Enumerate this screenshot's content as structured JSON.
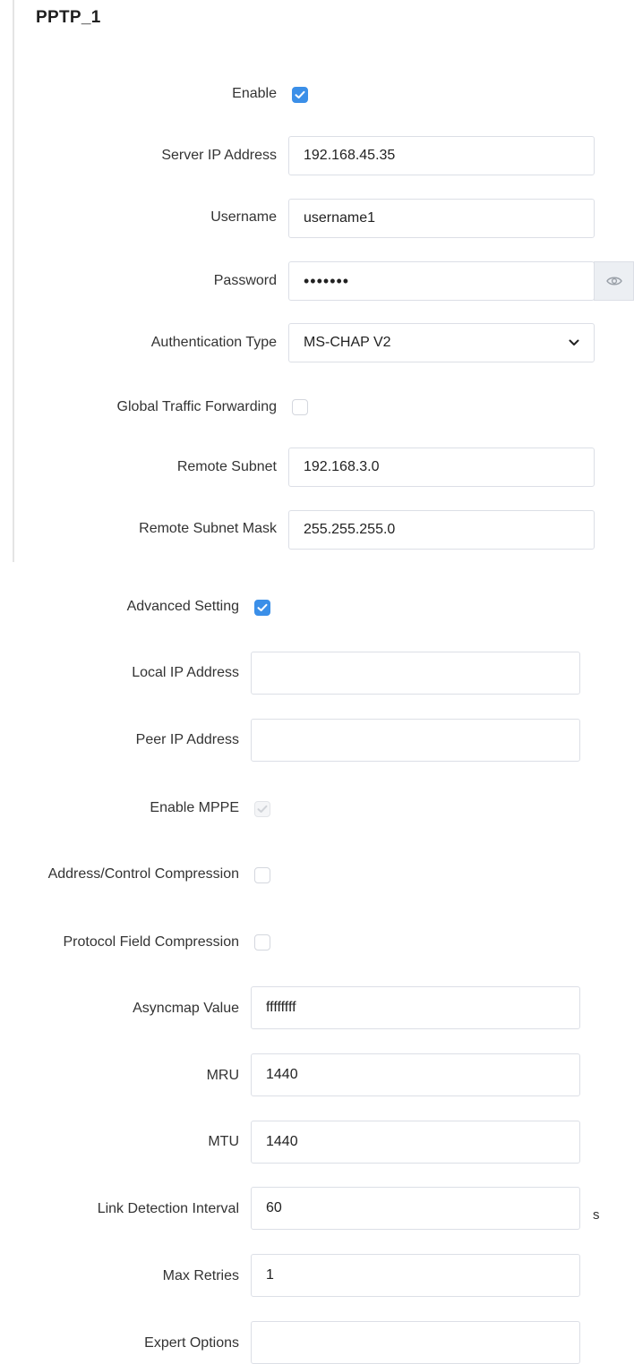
{
  "section": {
    "title": "PPTP_1"
  },
  "basic": {
    "enable_label": "Enable",
    "enable_checked": true,
    "server_ip_label": "Server IP Address",
    "server_ip_value": "192.168.45.35",
    "username_label": "Username",
    "username_value": "username1",
    "password_label": "Password",
    "password_value": "•••••••",
    "auth_label": "Authentication Type",
    "auth_value": "MS-CHAP V2",
    "global_forwarding_label": "Global Traffic Forwarding",
    "global_forwarding_checked": false,
    "remote_subnet_label": "Remote Subnet",
    "remote_subnet_value": "192.168.3.0",
    "remote_mask_label": "Remote Subnet Mask",
    "remote_mask_value": "255.255.255.0"
  },
  "advanced": {
    "advanced_label": "Advanced Setting",
    "advanced_checked": true,
    "local_ip_label": "Local IP Address",
    "local_ip_value": "",
    "peer_ip_label": "Peer IP Address",
    "peer_ip_value": "",
    "mppe_label": "Enable MPPE",
    "mppe_checked": true,
    "mppe_disabled": true,
    "addr_ctrl_label": "Address/Control Compression",
    "addr_ctrl_checked": false,
    "proto_field_label": "Protocol Field Compression",
    "proto_field_checked": false,
    "asyncmap_label": "Asyncmap Value",
    "asyncmap_value": "ffffffff",
    "mru_label": "MRU",
    "mru_value": "1440",
    "mtu_label": "MTU",
    "mtu_value": "1440",
    "link_interval_label": "Link Detection Interval",
    "link_interval_value": "60",
    "link_interval_unit": "s",
    "max_retries_label": "Max Retries",
    "max_retries_value": "1",
    "expert_label": "Expert Options",
    "expert_value": ""
  },
  "colors": {
    "accent": "#3b8fe8",
    "border": "#dcdfe6",
    "text": "#333333"
  },
  "icons": {
    "password_toggle": "eye-icon",
    "select_arrow": "chevron-down-icon",
    "checkmark": "check-icon"
  }
}
